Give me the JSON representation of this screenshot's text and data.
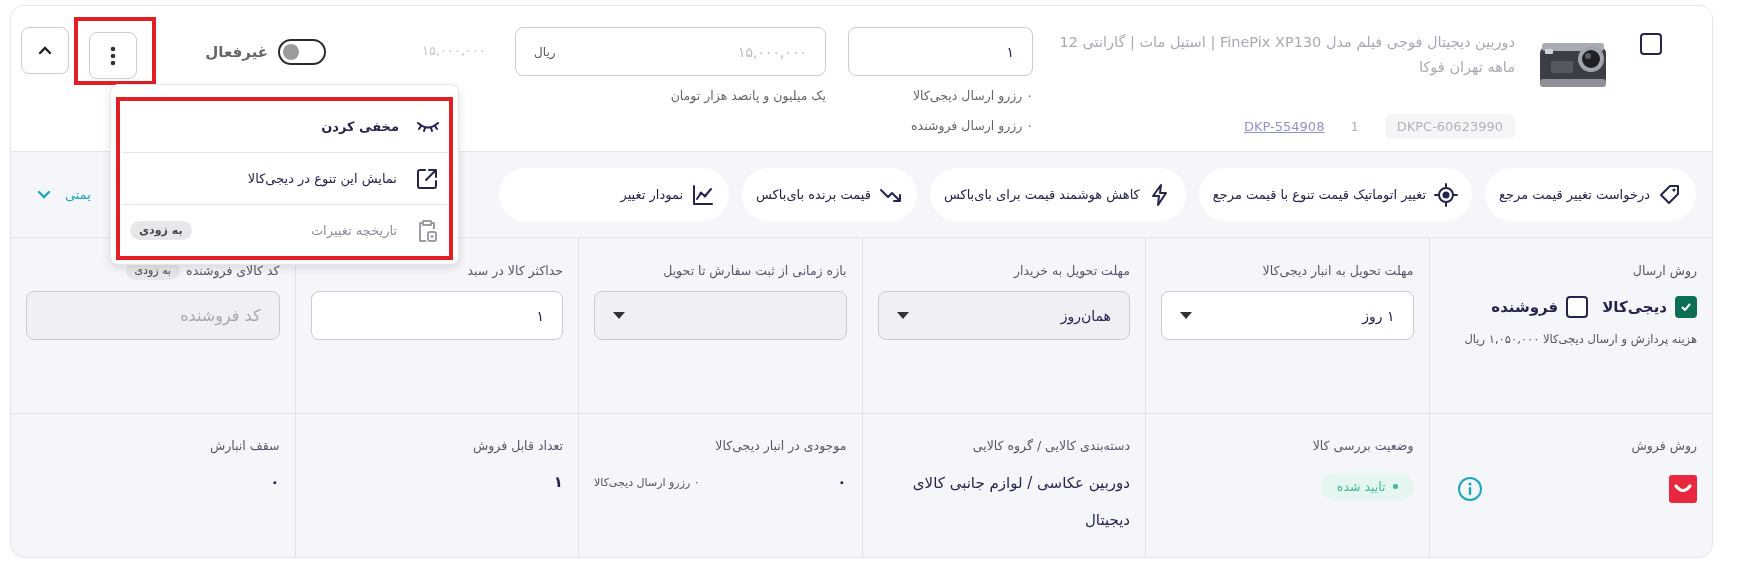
{
  "product": {
    "checked": false,
    "title": "دوربین دیجیتال فوجی فیلم مدل FinePix XP130 | استیل مات | گارانتی 12 ماهه تهران فوکا",
    "codes": [
      {
        "kind": "tag",
        "text": "DKPC-60623990"
      },
      {
        "kind": "plain",
        "text": "1"
      },
      {
        "kind": "link",
        "text": "DKP-554908"
      }
    ]
  },
  "stock": {
    "value": "۱",
    "notes": [
      "۰ رزرو ارسال دیجی‌کالا",
      "۰ رزرو ارسال فروشنده"
    ]
  },
  "price": {
    "placeholder": "۱۵,۰۰۰,۰۰۰",
    "unit": "ریال",
    "in_words": "یک میلیون و پانصد هزار تومان"
  },
  "reference_price": "۱۵,۰۰۰,۰۰۰",
  "status_toggle": {
    "label": "غیرفعال",
    "on": false
  },
  "more_button": {
    "highlighted": true
  },
  "menu": {
    "highlighted": true,
    "items": [
      {
        "kind": "hide",
        "label": "مخفی کردن",
        "selected": true,
        "disabled": false
      },
      {
        "kind": "external",
        "label": "نمایش این تنوع در دیجی‌کالا",
        "selected": false,
        "disabled": false
      },
      {
        "kind": "history",
        "label": "تاریخچه تغییرات",
        "selected": false,
        "disabled": true,
        "badge": "به زودی"
      }
    ]
  },
  "actions": [
    {
      "kind": "tag",
      "label": "درخواست تغییر قیمت مرجع"
    },
    {
      "kind": "target",
      "label": "تغییر اتوماتیک قیمت تنوع با قیمت مرجع"
    },
    {
      "kind": "bolt",
      "label": "کاهش هوشمند قیمت برای بای‌باکس"
    },
    {
      "kind": "trend",
      "label": "قیمت برنده بای‌باکس"
    },
    {
      "kind": "chart",
      "label": "نمودار تغییر"
    }
  ],
  "actions_toggle": {
    "label": "یمتی"
  },
  "fields": [
    {
      "kind": "shipping",
      "label": "روش ارسال",
      "options": [
        {
          "label": "دیجی‌کالا",
          "checked": true
        },
        {
          "label": "فروشنده",
          "checked": false
        }
      ],
      "note": "هزینه پردازش و ارسال دیجی‌کالا ۱,۰۵۰,۰۰۰ ریال"
    },
    {
      "kind": "select",
      "label": "مهلت تحویل به انبار دیجی‌کالا",
      "value": "۱ روز",
      "disabled": false
    },
    {
      "kind": "select",
      "label": "مهلت تحویل به خریدار",
      "value": "همان‌روز",
      "disabled": true
    },
    {
      "kind": "select",
      "label": "بازه زمانی از ثبت سفارش تا تحویل",
      "disabled": true
    },
    {
      "kind": "input",
      "label": "حداکثر کالا در سبد",
      "value": "۱",
      "disabled": false
    },
    {
      "kind": "input",
      "label": "کد کالای فروشنده",
      "badge": "به زودی",
      "placeholder": "کد فروشنده",
      "disabled": true
    }
  ],
  "details": [
    {
      "kind": "sale_method",
      "label": "روش فروش"
    },
    {
      "kind": "status",
      "label": "وضعیت بررسی کالا",
      "value": "تایید شده"
    },
    {
      "kind": "text",
      "label": "دسته‌بندی کالایی / گروه کالایی",
      "value": "دوربین عکاسی / لوازم جانبی کالای دیجیتال"
    },
    {
      "kind": "count",
      "label": "موجودی در انبار دیجی‌کالا",
      "value": "۰",
      "note": "۰ رزرو ارسال دیجی‌کالا"
    },
    {
      "kind": "count",
      "label": "تعداد قابل فروش",
      "value": "۱"
    },
    {
      "kind": "count",
      "label": "سقف انبارش",
      "value": "۰"
    }
  ]
}
